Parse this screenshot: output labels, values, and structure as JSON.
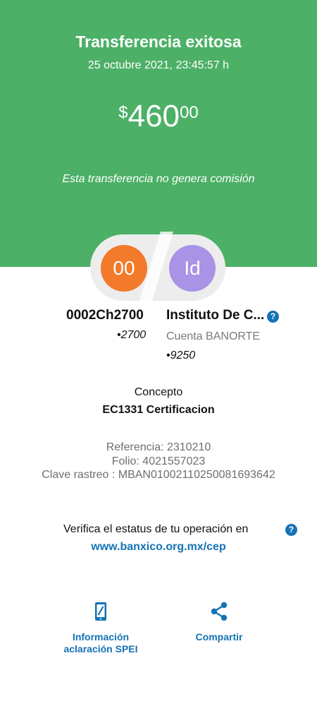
{
  "header": {
    "title": "Transferencia exitosa",
    "datetime": "25 octubre 2021, 23:45:57 h",
    "amount_currency": "$",
    "amount_integer": "460",
    "amount_decimals": "00",
    "commission_note": "Esta transferencia no genera comisión"
  },
  "origin": {
    "initials": "00",
    "name": "0002Ch2700",
    "account": "•2700"
  },
  "destination": {
    "initials": "Id",
    "name": "Instituto De C...",
    "bank": "Cuenta BANORTE",
    "account": "•9250"
  },
  "concept": {
    "label": "Concepto",
    "value": "EC1331 Certificacion"
  },
  "references": {
    "referencia": "Referencia: 2310210",
    "folio": "Folio: 4021557023",
    "clave_rastreo": "Clave rastreo : MBAN01002110250081693642"
  },
  "verify": {
    "text": "Verifica el estatus de tu operación en",
    "link": "www.banxico.org.mx/cep"
  },
  "actions": {
    "info_line1": "Información",
    "info_line2": "aclaración SPEI",
    "share": "Compartir"
  },
  "icons": {
    "help": "question-circle-icon",
    "info": "phone-document-icon",
    "share": "share-icon"
  },
  "colors": {
    "hero_green": "#4cb066",
    "origin_avatar": "#f27a2a",
    "destination_avatar": "#a893e6",
    "accent_blue": "#1473b4"
  }
}
